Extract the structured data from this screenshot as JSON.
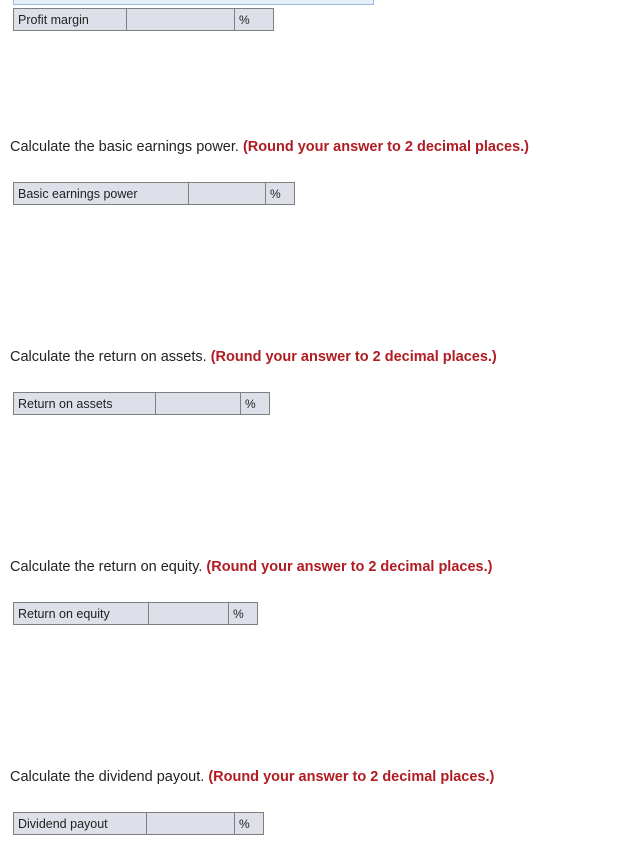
{
  "rows": [
    {
      "label": "Profit margin",
      "value": "",
      "unit": "%"
    },
    {
      "label": "Basic earnings power",
      "value": "",
      "unit": "%"
    },
    {
      "label": "Return on assets",
      "value": "",
      "unit": "%"
    },
    {
      "label": "Return on equity",
      "value": "",
      "unit": "%"
    },
    {
      "label": "Dividend payout",
      "value": "",
      "unit": "%"
    }
  ],
  "questions": [
    {
      "text": "Calculate the basic earnings power.",
      "note": "(Round your answer to 2 decimal places.)"
    },
    {
      "text": "Calculate the return on assets.",
      "note": "(Round your answer to 2 decimal places.)"
    },
    {
      "text": "Calculate the return on equity.",
      "note": "(Round your answer to 2 decimal places.)"
    },
    {
      "text": "Calculate the dividend payout.",
      "note": "(Round your answer to 2 decimal places.)"
    }
  ]
}
